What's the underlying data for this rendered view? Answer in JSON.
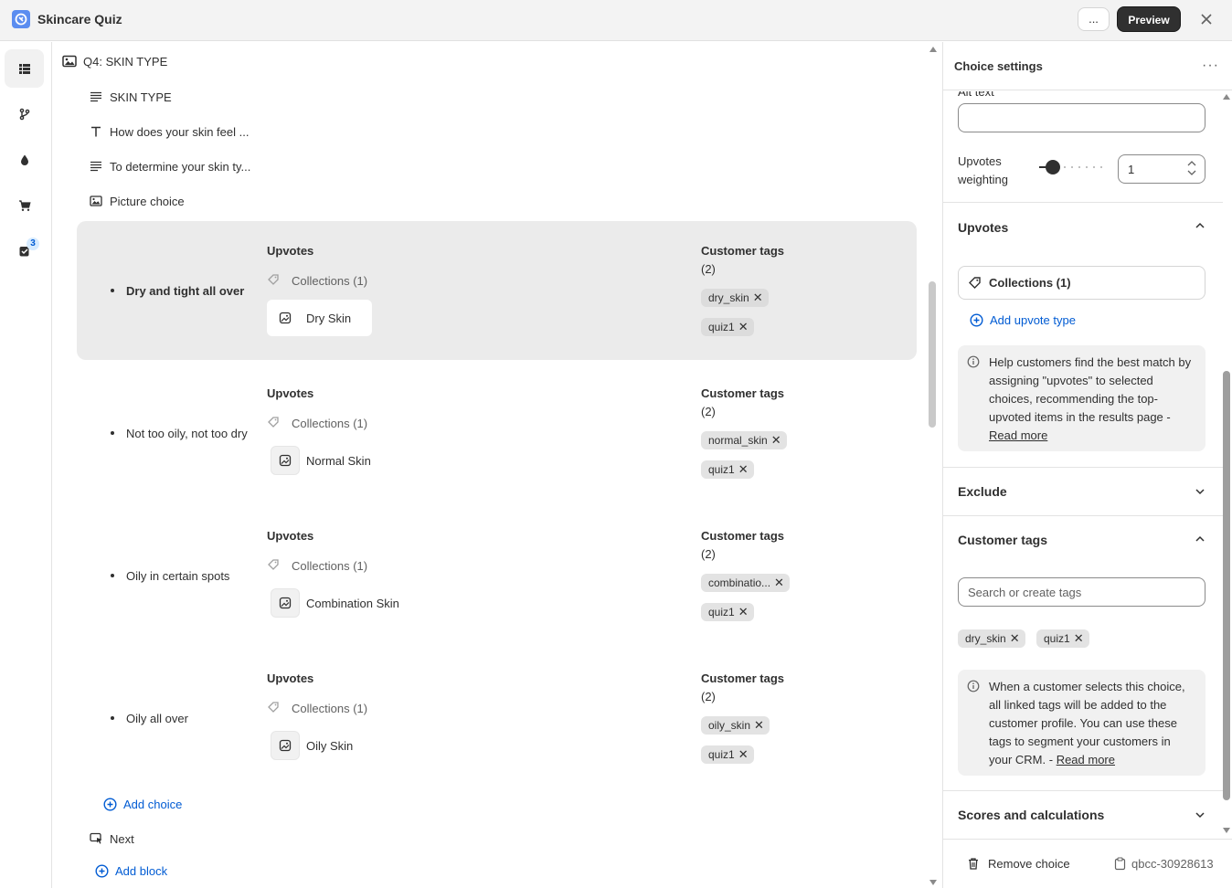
{
  "app": {
    "title": "Skincare Quiz",
    "more_label": "...",
    "preview_label": "Preview"
  },
  "rail": {
    "badge_count": "3"
  },
  "outline": {
    "question": "Q4: SKIN TYPE",
    "blocks": [
      {
        "label": "SKIN TYPE",
        "icon": "paragraph-icon"
      },
      {
        "label": "How does your skin feel ...",
        "icon": "text-icon"
      },
      {
        "label": "To determine your skin ty...",
        "icon": "paragraph-icon"
      },
      {
        "label": "Picture choice",
        "icon": "image-icon"
      }
    ],
    "choices": [
      {
        "label": "Dry and tight all over",
        "upvotes_title": "Upvotes",
        "collections": "Collections (1)",
        "item": "Dry Skin",
        "tags_title": "Customer tags",
        "tags_count": "(2)",
        "tags": [
          "dry_skin",
          "quiz1"
        ],
        "selected": true
      },
      {
        "label": "Not too oily, not too dry",
        "upvotes_title": "Upvotes",
        "collections": "Collections (1)",
        "item": "Normal Skin",
        "tags_title": "Customer tags",
        "tags_count": "(2)",
        "tags": [
          "normal_skin",
          "quiz1"
        ],
        "selected": false
      },
      {
        "label": "Oily in certain spots",
        "upvotes_title": "Upvotes",
        "collections": "Collections (1)",
        "item": "Combination Skin",
        "tags_title": "Customer tags",
        "tags_count": "(2)",
        "tags": [
          "combinatio...",
          "quiz1"
        ],
        "selected": false
      },
      {
        "label": "Oily all over",
        "upvotes_title": "Upvotes",
        "collections": "Collections (1)",
        "item": "Oily Skin",
        "tags_title": "Customer tags",
        "tags_count": "(2)",
        "tags": [
          "oily_skin",
          "quiz1"
        ],
        "selected": false
      }
    ],
    "add_choice": "Add choice",
    "next": "Next",
    "add_block": "Add block"
  },
  "panel": {
    "title": "Choice settings",
    "dots": "···",
    "alt_text_label": "Alt text",
    "alt_text_value": "",
    "weighting_label_1": "Upvotes",
    "weighting_label_2": "weighting",
    "weighting_value": "1",
    "weighting_slider_fraction": 0.1,
    "upvotes_title": "Upvotes",
    "collections_label": "Collections (1)",
    "add_upvote_type": "Add upvote type",
    "upvotes_info": "Help customers find the best match by assigning \"upvotes\" to selected choices, recommending the top-upvoted items in the results page -",
    "upvotes_read_more": "Read more",
    "exclude_title": "Exclude",
    "customer_tags_title": "Customer tags",
    "tags_placeholder": "Search or create tags",
    "tags": [
      "dry_skin",
      "quiz1"
    ],
    "tags_info": "When a customer selects this choice, all linked tags will be added to the customer profile. You can use these tags to segment your customers in your CRM. -",
    "tags_read_more": "Read more",
    "scores_title": "Scores and calculations",
    "remove_choice": "Remove choice",
    "choice_id": "qbcc-30928613"
  },
  "colors": {
    "accent": "#005bd3",
    "dark": "#303030",
    "selected_bg": "#ebebeb",
    "tag_bg": "#e3e3e3"
  }
}
